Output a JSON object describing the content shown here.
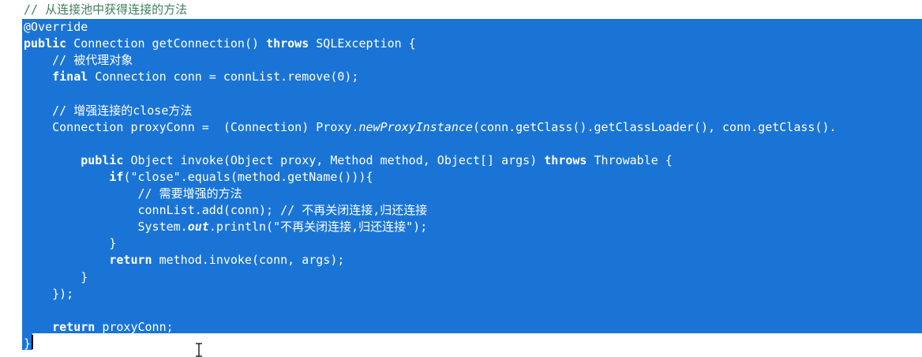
{
  "editor": {
    "header_comment": "// 从连接池中获得连接的方法",
    "lines": [
      [
        {
          "t": "@Override",
          "s": ""
        }
      ],
      [
        {
          "t": "public",
          "s": "kw"
        },
        {
          "t": " Connection getConnection() ",
          "s": ""
        },
        {
          "t": "throws",
          "s": "kw"
        },
        {
          "t": " SQLException {",
          "s": ""
        }
      ],
      [
        {
          "t": "    // 被代理对象",
          "s": ""
        }
      ],
      [
        {
          "t": "    ",
          "s": ""
        },
        {
          "t": "final",
          "s": "kw"
        },
        {
          "t": " Connection conn = connList.remove(0);",
          "s": ""
        }
      ],
      [],
      [
        {
          "t": "    // 增强连接的close方法",
          "s": ""
        }
      ],
      [
        {
          "t": "    Connection proxyConn =  (Connection) Proxy.",
          "s": ""
        },
        {
          "t": "newProxyInstance",
          "s": "it"
        },
        {
          "t": "(conn.getClass().getClassLoader(), conn.getClass().",
          "s": ""
        }
      ],
      [],
      [
        {
          "t": "        ",
          "s": ""
        },
        {
          "t": "public",
          "s": "kw"
        },
        {
          "t": " Object invoke(Object proxy, Method method, Object[] args) ",
          "s": ""
        },
        {
          "t": "throws",
          "s": "kw"
        },
        {
          "t": " Throwable {",
          "s": ""
        }
      ],
      [
        {
          "t": "            ",
          "s": ""
        },
        {
          "t": "if",
          "s": "kw"
        },
        {
          "t": "(\"close\".equals(method.getName())){",
          "s": ""
        }
      ],
      [
        {
          "t": "                // 需要增强的方法",
          "s": ""
        }
      ],
      [
        {
          "t": "                connList.add(conn); // 不再关闭连接,归还连接",
          "s": ""
        }
      ],
      [
        {
          "t": "                System.",
          "s": ""
        },
        {
          "t": "out",
          "s": "bi"
        },
        {
          "t": ".println(\"不再关闭连接,归还连接\");",
          "s": ""
        }
      ],
      [
        {
          "t": "            }",
          "s": ""
        }
      ],
      [
        {
          "t": "            ",
          "s": ""
        },
        {
          "t": "return",
          "s": "kw"
        },
        {
          "t": " method.invoke(conn, args);",
          "s": ""
        }
      ],
      [
        {
          "t": "        }",
          "s": ""
        }
      ],
      [
        {
          "t": "    });",
          "s": ""
        }
      ],
      [],
      [
        {
          "t": "    ",
          "s": ""
        },
        {
          "t": "return",
          "s": "kw"
        },
        {
          "t": " proxyConn;",
          "s": ""
        }
      ],
      [
        {
          "t": "}",
          "s": ""
        }
      ]
    ]
  },
  "colors": {
    "selection": "#1a74d6",
    "selected_text": "#ffffff",
    "comment": "#3f7f5f",
    "background": "#ffffff"
  }
}
